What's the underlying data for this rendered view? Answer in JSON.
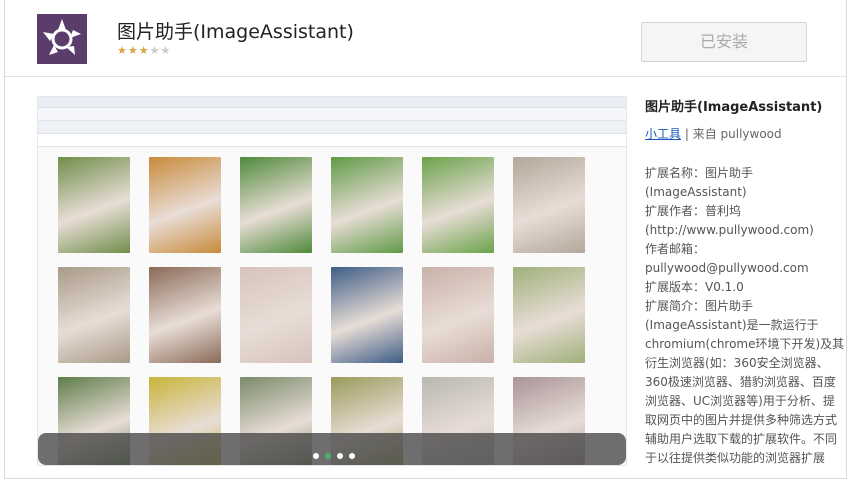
{
  "extension": {
    "name": "图片助手(ImageAssistant)",
    "rating": 3,
    "rating_max": 5,
    "install_button": "已安装"
  },
  "sidebar": {
    "title": "图片助手(ImageAssistant)",
    "category_link": "小工具",
    "separator": "|",
    "source": "来自 pullywood",
    "details": [
      "扩展名称：图片助手",
      "(ImageAssistant)",
      "扩展作者：普利坞",
      "(http://www.pullywood.com)",
      "作者邮箱：",
      "pullywood@pullywood.com",
      "扩展版本：V0.1.0",
      "扩展简介：图片助手",
      "(ImageAssistant)是一款运行于",
      "chromium(chrome环境下开发)及其",
      "衍生浏览器(如：360安全浏览器、",
      "360极速浏览器、猎豹浏览器、百度",
      "浏览器、UC浏览器等)用于分析、提",
      "取网页中的图片并提供多种筛选方式",
      "辅助用户选取下载的扩展软件。不同",
      "于以往提供类似功能的浏览器扩展"
    ]
  },
  "carousel": {
    "slide_count": 4,
    "active_index": 1
  },
  "thumb_colors": [
    "#6f8e4a",
    "#c98a3a",
    "#4f8a3a",
    "#5f9a45",
    "#6aa24a",
    "#b3a79a",
    "#a89a88",
    "#8a6a58",
    "#d6c3bd",
    "#3e5d86",
    "#c9b1a8",
    "#9fb07a",
    "#5e7d4a",
    "#c8b43a",
    "#7a8a6a",
    "#9a9a5a",
    "#b8b8b0",
    "#a89498"
  ]
}
